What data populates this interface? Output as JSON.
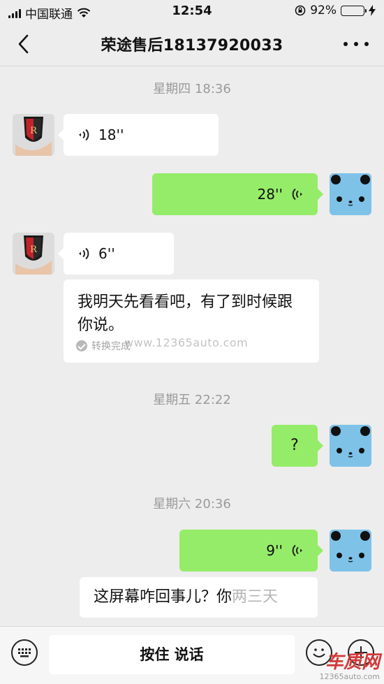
{
  "status_bar": {
    "carrier": "中国联通",
    "time": "12:54",
    "battery_percent": "92%",
    "battery_level": 0.92
  },
  "nav": {
    "title": "荣途售后18137920033"
  },
  "messages": {
    "ts1": "星期四 18:36",
    "m1_duration": "18''",
    "m2_duration": "28''",
    "m3_duration": "6''",
    "m4_text": "我明天先看看吧，有了到时候跟你说。",
    "m4_status": "转换完成",
    "ts2": "星期五 22:22",
    "m5_text": "?",
    "ts3": "星期六 20:36",
    "m6_duration": "9''",
    "m7_text": "这屏幕咋回事儿？你",
    "m7_text_faded": "两三天"
  },
  "input_bar": {
    "hold_to_talk": "按住 说话"
  },
  "watermark": {
    "center": "www.12365auto.com",
    "logo": "车质网",
    "logo_url": "12365auto.com"
  },
  "colors": {
    "outgoing_bubble": "#95ec69",
    "incoming_bubble": "#ffffff",
    "background": "#ededed",
    "panda_avatar": "#7ec2e8"
  }
}
